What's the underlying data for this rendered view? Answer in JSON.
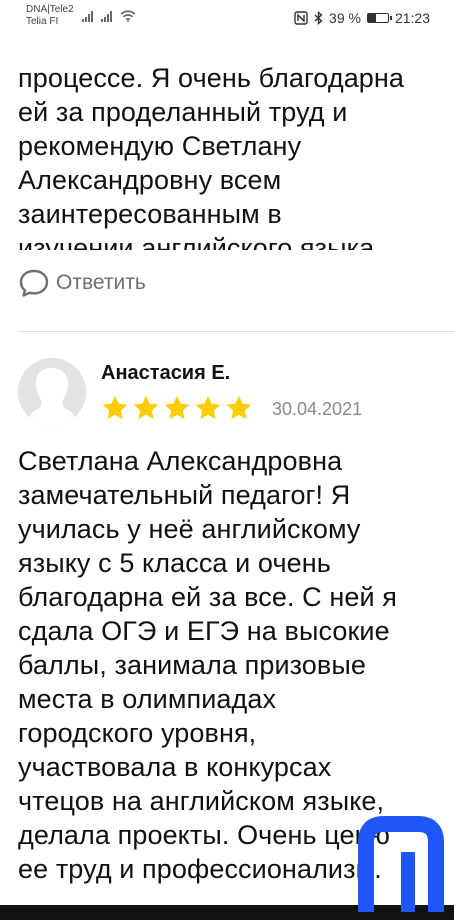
{
  "status_bar": {
    "carrier_line1": "DNA|Tele2",
    "carrier_line2": "Telia FI",
    "battery_text": "39 %",
    "time": "21:23",
    "battery_level": 0.39
  },
  "review_prev": {
    "text": "процессе. Я очень благодарна\nей за проделанный труд и\nрекомендую Светлану\nАлександровну всем\nзаинтересованным в\nизучении английского языка.",
    "reply_label": "Ответить"
  },
  "review": {
    "author": "Анастасия Е.",
    "rating": 5,
    "date": "30.04.2021",
    "text": "Светлана Александровна\nзамечательный педагог! Я\nучилась у неё английскому\nязыку с 5 класса и очень\nблагодарна ей за все. С ней я\nсдала ОГЭ и ЕГЭ на высокие\nбаллы, занимала призовые\nместа в олимпиадах\nгородского уровня,\nучаствовала в конкурсах\nчтецов на английском языке,\nделала проекты. Очень ценю\nее труд и профессионализм."
  },
  "colors": {
    "star": "#FFCC00",
    "logo": "#1E57F5",
    "text": "#111111",
    "muted": "#8A8A8A"
  },
  "icons": {
    "reply": "speech-bubble-icon",
    "avatar": "user-silhouette-icon",
    "star": "star-icon",
    "logo": "brand-logo"
  }
}
